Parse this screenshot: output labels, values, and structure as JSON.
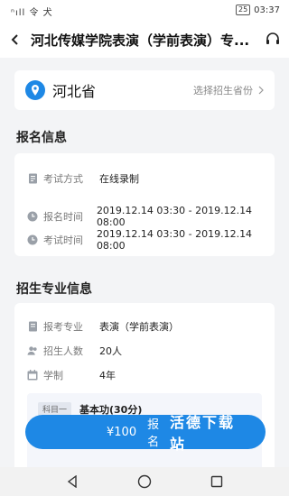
{
  "status_bar": {
    "signal": "ⁿıll 令 犬",
    "battery": "25",
    "time": "03:37"
  },
  "header": {
    "title": "河北传媒学院表演（学前表演）专..."
  },
  "province": {
    "name": "河北省",
    "action": "选择招生省份"
  },
  "registration": {
    "title": "报名信息",
    "rows": [
      {
        "label": "考试方式",
        "value": "在线录制"
      },
      {
        "label": "报名时间",
        "value": "2019.12.14 03:30 - 2019.12.14 08:00"
      },
      {
        "label": "考试时间",
        "value": "2019.12.14 03:30 - 2019.12.14 08:00"
      }
    ]
  },
  "major": {
    "title": "招生专业信息",
    "rows": [
      {
        "label": "报考专业",
        "value": "表演（学前表演）"
      },
      {
        "label": "招生人数",
        "value": "20人"
      },
      {
        "label": "学制",
        "value": "4年"
      }
    ],
    "subject": {
      "tag": "科目一",
      "text": "基本功(30分)"
    }
  },
  "cta": {
    "price": "¥100",
    "action": "报名",
    "label": "活德下载站"
  },
  "colors": {
    "accent": "#1e88e5",
    "bg": "#f3f4f6"
  }
}
